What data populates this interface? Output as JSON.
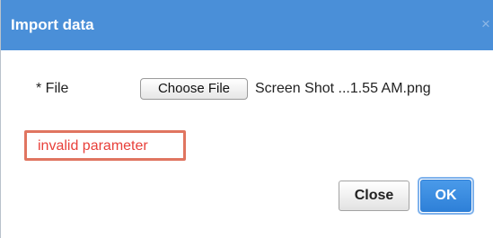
{
  "dialog": {
    "title": "Import data",
    "close_glyph": "×"
  },
  "form": {
    "file_label": "* File",
    "choose_file_label": "Choose File",
    "selected_file_name": "Screen Shot ...1.55 AM.png"
  },
  "error": {
    "message": "invalid parameter",
    "color": "#e8403a"
  },
  "buttons": {
    "close_label": "Close",
    "ok_label": "OK"
  },
  "colors": {
    "titlebar": "#4a8fd8",
    "ok_button": "#2e80d8",
    "highlight_box": "#e07560"
  }
}
